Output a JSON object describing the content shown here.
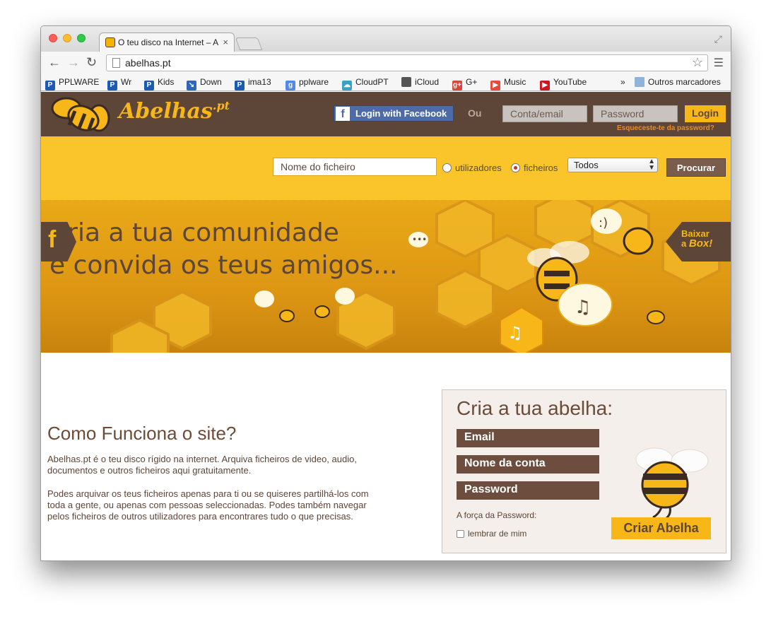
{
  "browser": {
    "tab_title": "O teu disco na Internet – A",
    "tab_close": "×",
    "url": "abelhas.pt",
    "bookmarks": [
      {
        "label": "PPLWARE",
        "color": "#1d5ab4",
        "icon": "P"
      },
      {
        "label": "Wr",
        "color": "#1d5ab4",
        "icon": "P"
      },
      {
        "label": "Kids",
        "color": "#1d5ab4",
        "icon": "P"
      },
      {
        "label": "Down",
        "color": "#2c6ab9",
        "icon": "↘"
      },
      {
        "label": "ima13",
        "color": "#1d5ab4",
        "icon": "P"
      },
      {
        "label": "pplware",
        "color": "#4f8ae8",
        "icon": "g"
      },
      {
        "label": "CloudPT",
        "color": "#3aa0c8",
        "icon": "☁"
      },
      {
        "label": "iCloud",
        "color": "#555555",
        "icon": ""
      },
      {
        "label": "G+",
        "color": "#d34836",
        "icon": "g+"
      },
      {
        "label": "Music",
        "color": "#e84a3a",
        "icon": "▶"
      },
      {
        "label": "YouTube",
        "color": "#cc181e",
        "icon": "▶"
      }
    ],
    "more_bookmarks": "»",
    "other_bookmarks": "Outros marcadores"
  },
  "header": {
    "logo_text": "Abelhas",
    "logo_suffix": ".pt",
    "fb_login": "Login with Facebook",
    "or_text": "Ou",
    "account_placeholder": "Conta/email",
    "password_placeholder": "Password",
    "login_button": "Login",
    "forgot_password": "Esqueceste-te da password?"
  },
  "search": {
    "placeholder": "Nome do ficheiro",
    "radio_users": "utilizadores",
    "radio_files": "ficheiros",
    "selected_radio": "ficheiros",
    "category": "Todos",
    "button": "Procurar"
  },
  "banner": {
    "line1": "Cria a tua comunidade",
    "line2": "e convida os teus amigos...",
    "facebook_tab": "f",
    "download_line1": "Baixar",
    "download_line2": "a",
    "download_line3": "Box!"
  },
  "how": {
    "title": "Como Funciona o site?",
    "p1": "Abelhas.pt é o teu disco rígido na internet. Arquiva ficheiros de video, audio, documentos e outros ficheiros aqui gratuitamente.",
    "p2": "Podes arquivar os teus ficheiros apenas para ti ou se quiseres partilhá-los com toda a gente, ou apenas com pessoas seleccionadas. Podes também navegar pelos ficheiros de outros utilizadores para encontrares tudo o que precisas."
  },
  "signup": {
    "title": "Cria a tua abelha:",
    "email": "Email",
    "account_name": "Nome da conta",
    "password": "Password",
    "password_strength": "A força da Password:",
    "remember": "lembrar de mim",
    "create_button": "Criar Abelha"
  },
  "colors": {
    "brown": "#5d4538",
    "yellow": "#f7b718",
    "orange_banner": "#e9a917"
  }
}
